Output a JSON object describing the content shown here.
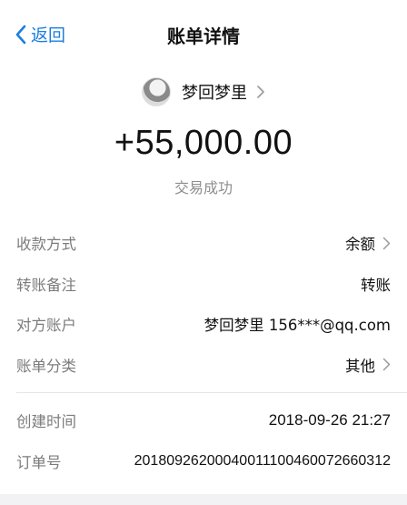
{
  "nav": {
    "back_label": "返回",
    "title": "账单详情"
  },
  "user": {
    "name": "梦回梦里"
  },
  "transaction": {
    "amount": "+55,000.00",
    "status": "交易成功"
  },
  "details": [
    {
      "label": "收款方式",
      "value": "余额"
    },
    {
      "label": "转账备注",
      "value": "转账"
    },
    {
      "label": "对方账户",
      "value": "梦回梦里 156***@qq.com"
    },
    {
      "label": "账单分类",
      "value": "其他"
    }
  ],
  "meta": [
    {
      "label": "创建时间",
      "value": "2018-09-26 21:27"
    },
    {
      "label": "订单号",
      "value": "2018092620004001110046007266031​2"
    }
  ],
  "colors": {
    "accent": "#1c7ee0",
    "label": "#7c7c7c",
    "background": "#ffffff"
  }
}
